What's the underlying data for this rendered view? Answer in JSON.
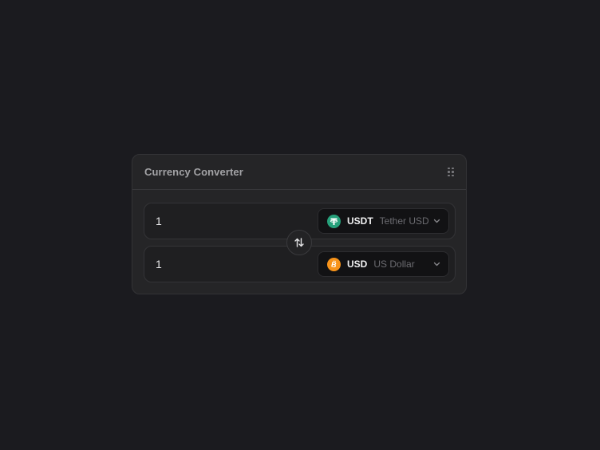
{
  "widget": {
    "title": "Currency Converter",
    "drag_icon": "drag-handle-icon"
  },
  "from": {
    "amount": "1",
    "currency_code": "USDT",
    "currency_name": "Tether USD",
    "icon": "tether-icon",
    "icon_color": "#26a17b"
  },
  "to": {
    "amount": "1",
    "currency_code": "USD",
    "currency_name": "US Dollar",
    "icon": "bitcoin-icon",
    "icon_color": "#f7931a"
  },
  "swap": {
    "icon": "swap-arrows-icon"
  },
  "colors": {
    "background": "#1b1b1f",
    "card": "#252527",
    "selector": "#121214"
  }
}
